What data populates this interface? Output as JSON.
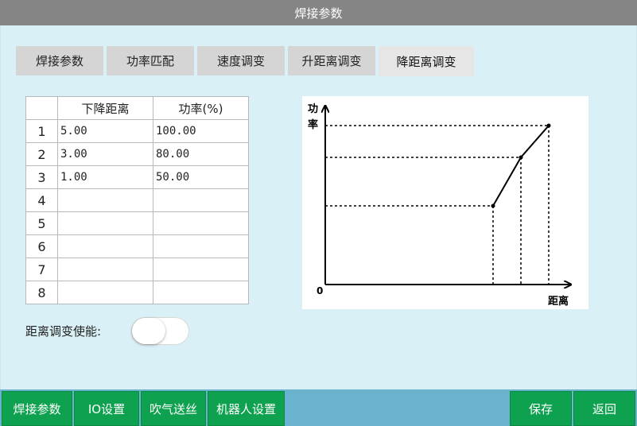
{
  "window": {
    "title": "焊接参数"
  },
  "tabs": [
    {
      "label": "焊接参数"
    },
    {
      "label": "功率匹配"
    },
    {
      "label": "速度调变"
    },
    {
      "label": "升距离调变"
    },
    {
      "label": "降距离调变"
    }
  ],
  "active_tab": 4,
  "table": {
    "headers": [
      "",
      "下降距离",
      "功率(%)"
    ],
    "rows": [
      {
        "index": "1",
        "distance": "5.00",
        "power": "100.00"
      },
      {
        "index": "2",
        "distance": "3.00",
        "power": "80.00"
      },
      {
        "index": "3",
        "distance": "1.00",
        "power": "50.00"
      },
      {
        "index": "4",
        "distance": "",
        "power": ""
      },
      {
        "index": "5",
        "distance": "",
        "power": ""
      },
      {
        "index": "6",
        "distance": "",
        "power": ""
      },
      {
        "index": "7",
        "distance": "",
        "power": ""
      },
      {
        "index": "8",
        "distance": "",
        "power": ""
      }
    ]
  },
  "diagram": {
    "y_label_line1": "功",
    "y_label_line2": "率",
    "x_label": "距离",
    "origin_label": "0"
  },
  "enable": {
    "label": "距离调变使能:",
    "on": false
  },
  "bottom_nav": {
    "weld_params": "焊接参数",
    "io_settings": "IO设置",
    "blow_feed": "吹气送丝",
    "robot_settings": "机器人设置",
    "save": "保存",
    "back": "返回"
  },
  "colors": {
    "title_bar": "#858585",
    "panel_bg": "#d9f0f6",
    "bottom_bar": "#6ab3cf",
    "button_green": "#0ea14f"
  }
}
